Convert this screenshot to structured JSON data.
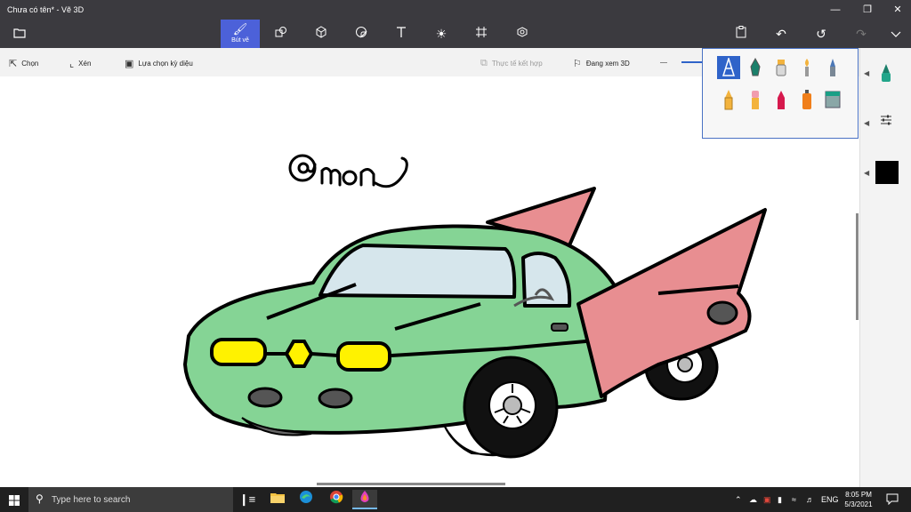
{
  "window": {
    "title": "Chưa có tên* - Vẽ 3D",
    "minimize_icon": "minimize-icon",
    "maximize_icon": "restore-icon",
    "close_icon": "close-icon"
  },
  "toolbar": {
    "menu_icon": "folder-icon",
    "tabs": [
      {
        "name": "brushes",
        "label": "Bút vẽ",
        "icon": "brush-icon",
        "active": true
      },
      {
        "name": "2d-shapes",
        "icon": "shapes-2d-icon"
      },
      {
        "name": "3d-shapes",
        "icon": "cube-icon"
      },
      {
        "name": "stickers",
        "icon": "sticker-icon"
      },
      {
        "name": "text",
        "icon": "text-icon"
      },
      {
        "name": "effects",
        "icon": "effects-icon"
      },
      {
        "name": "canvas",
        "icon": "canvas-icon"
      },
      {
        "name": "3d-library",
        "icon": "library-icon"
      }
    ],
    "right_icons": [
      "paste-icon",
      "undo-icon",
      "history-icon",
      "redo-icon",
      "expand-icon"
    ],
    "accent": "#4c61d9"
  },
  "subbar": {
    "select_label": "Chọn",
    "crop_label": "Xén",
    "magic_select_label": "Lựa chọn kỳ diệu",
    "mixed_reality_label": "Thực tế kết hợp",
    "view3d_label": "Đang xem 3D"
  },
  "brush_panel": {
    "brushes": [
      {
        "name": "marker",
        "icon": "marker-brush-icon",
        "selected": true
      },
      {
        "name": "calligraphy-pen",
        "icon": "calligraphy-pen-icon"
      },
      {
        "name": "oil-brush",
        "icon": "oil-brush-icon"
      },
      {
        "name": "watercolor",
        "icon": "watercolor-brush-icon"
      },
      {
        "name": "pixel-pen",
        "icon": "pixel-pen-icon"
      },
      {
        "name": "pencil",
        "icon": "pencil-icon"
      },
      {
        "name": "eraser",
        "icon": "eraser-icon"
      },
      {
        "name": "crayon",
        "icon": "crayon-icon"
      },
      {
        "name": "spray-can",
        "icon": "spray-can-icon"
      },
      {
        "name": "fill",
        "icon": "fill-bucket-icon"
      }
    ]
  },
  "side_panel": {
    "tool_icon": "marker-icon",
    "settings_icon": "sliders-icon",
    "current_color": "#000000"
  },
  "drawing": {
    "signature": "@mon",
    "body_color": "#85d495",
    "fin_color": "#e88e91",
    "window_color": "#d6e6ec",
    "light_color": "#fff200"
  },
  "taskbar": {
    "search_placeholder": "Type here to search",
    "apps": [
      "task-view-icon",
      "file-explorer-icon",
      "edge-icon",
      "chrome-icon",
      "paint-3d-icon"
    ],
    "language": "ENG",
    "time": "8:05 PM",
    "date": "5/3/2021"
  }
}
